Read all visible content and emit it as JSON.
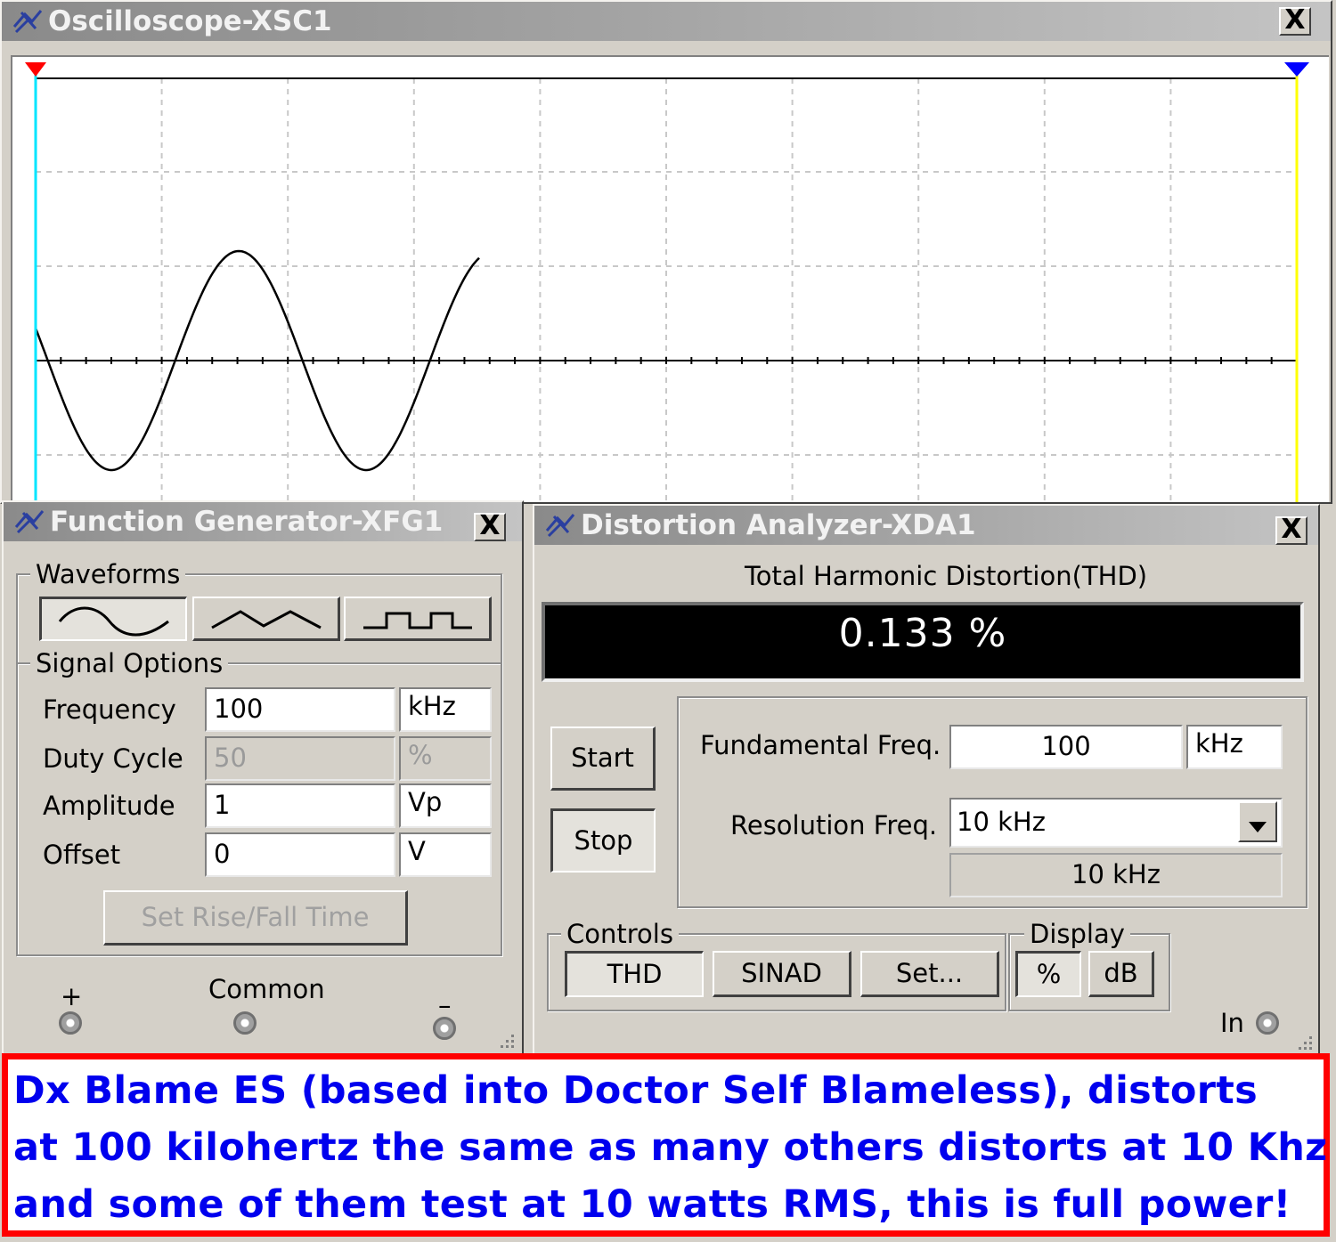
{
  "oscilloscope": {
    "title": "Oscilloscope-XSC1",
    "close_label": "X",
    "trace_color": "#000000",
    "cursor1_color": "#00e5ff",
    "cursor2_color": "#ffff00",
    "marker1_color": "#ff0000",
    "marker2_color": "#0000ff"
  },
  "function_generator": {
    "title": "Function Generator-XFG1",
    "close_label": "X",
    "waveforms_label": "Waveforms",
    "waveform_buttons": [
      "sine-wave-icon",
      "triangle-wave-icon",
      "square-wave-icon"
    ],
    "selected_waveform": "sine",
    "signal_options_label": "Signal Options",
    "fields": [
      {
        "label": "Frequency",
        "value": "100",
        "unit": "kHz",
        "disabled": false
      },
      {
        "label": "Duty Cycle",
        "value": "50",
        "unit": "%",
        "disabled": true
      },
      {
        "label": "Amplitude",
        "value": "1",
        "unit": "Vp",
        "disabled": false
      },
      {
        "label": "Offset",
        "value": "0",
        "unit": "V",
        "disabled": false
      }
    ],
    "rise_fall_button": "Set Rise/Fall Time",
    "terminal_plus": "+",
    "terminal_common": "Common",
    "terminal_minus": "–"
  },
  "distortion_analyzer": {
    "title": "Distortion Analyzer-XDA1",
    "close_label": "X",
    "thd_heading": "Total Harmonic Distortion(THD)",
    "reading": "0.133 %",
    "start_button": "Start",
    "stop_button": "Stop",
    "fundamental_label": "Fundamental Freq.",
    "fundamental_value": "100",
    "fundamental_unit": "kHz",
    "resolution_label": "Resolution Freq.",
    "resolution_selected": "10 kHz",
    "resolution_readout": "10 kHz",
    "controls_label": "Controls",
    "controls_buttons": [
      "THD",
      "SINAD",
      "Set..."
    ],
    "display_label": "Display",
    "display_buttons": [
      "%",
      "dB"
    ],
    "in_label": "In"
  },
  "banner": {
    "lines": [
      "Dx Blame ES (based into Doctor Self Blameless), distorts",
      "at 100 kilohertz the same as many others distorts at 10 Khz",
      "and some of them test at 10 watts RMS, this is full power!"
    ],
    "text_color": "#0000ee",
    "border_color": "#ff0000"
  }
}
